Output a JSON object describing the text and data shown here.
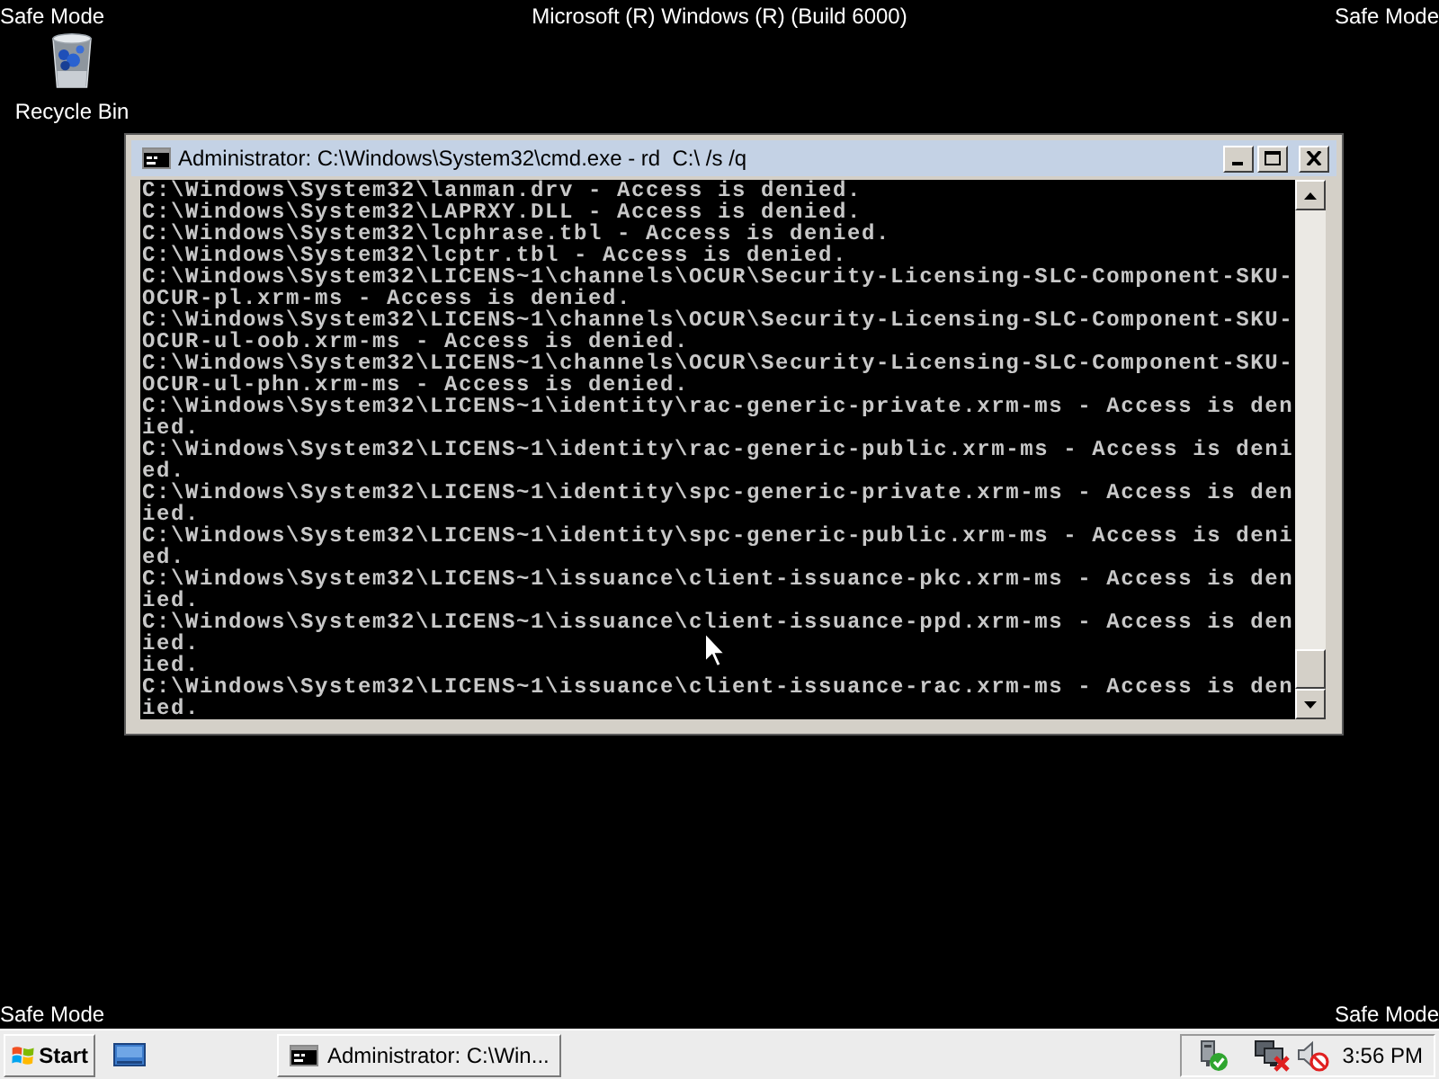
{
  "desktop": {
    "header": {
      "left": "Safe Mode",
      "center": "Microsoft (R) Windows (R) (Build 6000)",
      "right": "Safe Mode"
    },
    "icons": [
      {
        "label": "Recycle Bin"
      }
    ],
    "footer": {
      "left": "Safe Mode",
      "right": "Safe Mode"
    }
  },
  "window": {
    "title": "Administrator: C:\\Windows\\System32\\cmd.exe - rd  C:\\ /s /q",
    "console_lines": [
      "C:\\Windows\\System32\\lanman.drv - Access is denied.",
      "C:\\Windows\\System32\\LAPRXY.DLL - Access is denied.",
      "C:\\Windows\\System32\\lcphrase.tbl - Access is denied.",
      "C:\\Windows\\System32\\lcptr.tbl - Access is denied.",
      "C:\\Windows\\System32\\LICENS~1\\channels\\OCUR\\Security-Licensing-SLC-Component-SKU-",
      "OCUR-pl.xrm-ms - Access is denied.",
      "C:\\Windows\\System32\\LICENS~1\\channels\\OCUR\\Security-Licensing-SLC-Component-SKU-",
      "OCUR-ul-oob.xrm-ms - Access is denied.",
      "C:\\Windows\\System32\\LICENS~1\\channels\\OCUR\\Security-Licensing-SLC-Component-SKU-",
      "OCUR-ul-phn.xrm-ms - Access is denied.",
      "C:\\Windows\\System32\\LICENS~1\\identity\\rac-generic-private.xrm-ms - Access is den",
      "ied.",
      "C:\\Windows\\System32\\LICENS~1\\identity\\rac-generic-public.xrm-ms - Access is deni",
      "ed.",
      "C:\\Windows\\System32\\LICENS~1\\identity\\spc-generic-private.xrm-ms - Access is den",
      "ied.",
      "C:\\Windows\\System32\\LICENS~1\\identity\\spc-generic-public.xrm-ms - Access is deni",
      "ed.",
      "C:\\Windows\\System32\\LICENS~1\\issuance\\client-issuance-pkc.xrm-ms - Access is den",
      "ied.",
      "C:\\Windows\\System32\\LICENS~1\\issuance\\client-issuance-ppd.xrm-ms - Access is den",
      "ied.",
      "ied.",
      "C:\\Windows\\System32\\LICENS~1\\issuance\\client-issuance-rac.xrm-ms - Access is den",
      "ied."
    ]
  },
  "taskbar": {
    "start_button": "Start",
    "tasks": [
      {
        "label": "Administrator: C:\\Win...",
        "selected": false
      }
    ],
    "clock": "3:56 PM"
  }
}
